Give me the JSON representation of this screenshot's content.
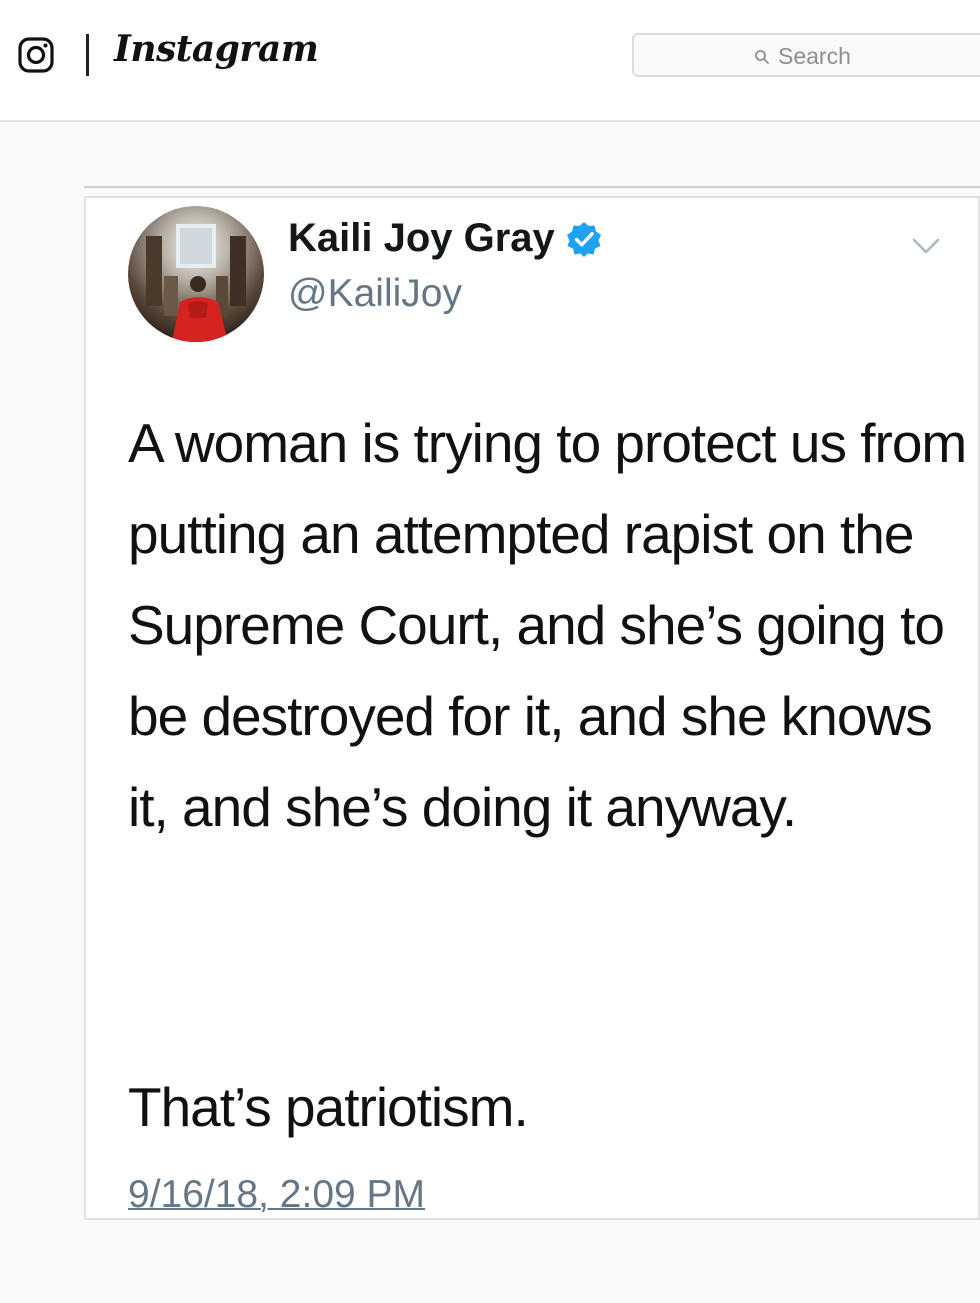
{
  "header": {
    "wordmark": "Instagram",
    "search_placeholder": "Search",
    "icons": [
      "instagram-logo-icon",
      "search-icon"
    ]
  },
  "tweet": {
    "display_name": "Kaili Joy Gray",
    "handle": "@KailiJoy",
    "verified": true,
    "body": "A woman is trying to protect us from putting an attempted rapist on the Supreme Court, and she’s going to be destroyed for it, and she knows it, and she’s doing it anyway.",
    "closing": "That’s patriotism.",
    "timestamp": "9/16/18, 2:09 PM",
    "icons": [
      "avatar",
      "verified-badge-icon",
      "chevron-down-icon"
    ]
  },
  "colors": {
    "verified_blue": "#1da1f2",
    "secondary_text": "#657786",
    "page_background": "#fafafa"
  }
}
